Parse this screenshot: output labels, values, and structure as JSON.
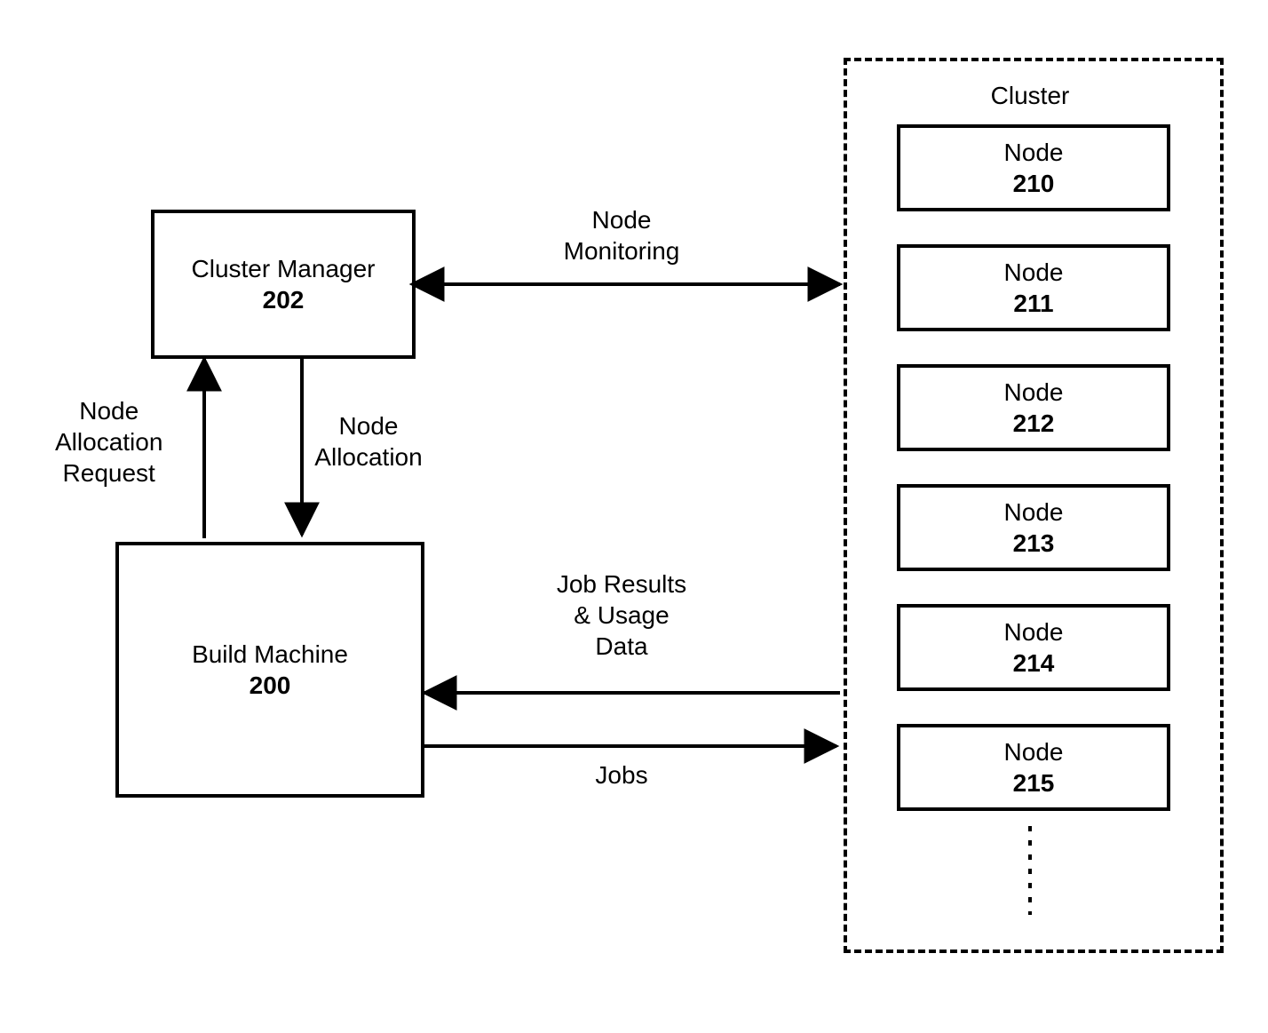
{
  "boxes": {
    "clusterManager": {
      "label": "Cluster\nManager",
      "num": "202"
    },
    "buildMachine": {
      "label": "Build Machine",
      "num": "200"
    },
    "clusterContainer": {
      "title": "Cluster"
    },
    "nodes": [
      {
        "label": "Node",
        "num": "210"
      },
      {
        "label": "Node",
        "num": "211"
      },
      {
        "label": "Node",
        "num": "212"
      },
      {
        "label": "Node",
        "num": "213"
      },
      {
        "label": "Node",
        "num": "214"
      },
      {
        "label": "Node",
        "num": "215"
      }
    ]
  },
  "arrowLabels": {
    "nodeMonitoring": "Node\nMonitoring",
    "nodeAllocationRequest": "Node\nAllocation\nRequest",
    "nodeAllocation": "Node\nAllocation",
    "jobResultsUsage": "Job Results\n& Usage\nData",
    "jobs": "Jobs"
  },
  "ellipsis": "⋮"
}
